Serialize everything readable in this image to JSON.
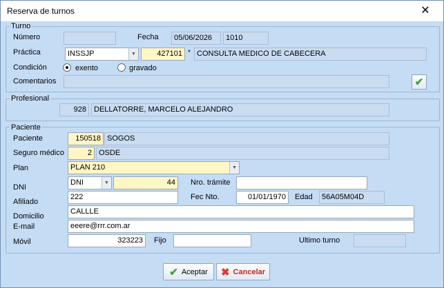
{
  "window": {
    "title": "Reserva de turnos",
    "close_glyph": "✕"
  },
  "turno": {
    "legend": "Turno",
    "numero_label": "Número",
    "numero_value": "",
    "fecha_label": "Fecha",
    "fecha_value": "05/06/2026",
    "hora_value": "1010",
    "practica_label": "Práctica",
    "practica_combo": "INSSJP",
    "practica_code": "427101",
    "practica_marker": "*",
    "practica_desc": "CONSULTA MEDICO DE CABECERA",
    "condicion_label": "Condición",
    "exento_label": "exento",
    "gravado_label": "gravado",
    "comentarios_label": "Comentarios",
    "comentarios_value": ""
  },
  "profesional": {
    "legend": "Profesional",
    "code": "928",
    "name": "DELLATORRE, MARCELO ALEJANDRO"
  },
  "paciente": {
    "legend": "Paciente",
    "paciente_label": "Paciente",
    "paciente_code": "150518",
    "paciente_name": "SOGOS",
    "seguro_label": "Seguro médico",
    "seguro_code": "2",
    "seguro_name": "OSDE",
    "plan_label": "Plan",
    "plan_value": "PLAN 210",
    "dni_label": "DNI",
    "dni_type": "DNI",
    "dni_value": "44",
    "tramite_label": "Nro. trámite",
    "tramite_value": "",
    "afiliado_label": "Afiliado",
    "afiliado_value": "222",
    "fecnto_label": "Fec Nto.",
    "fecnto_value": "01/01/1970",
    "edad_label": "Edad",
    "edad_value": "56A05M04D",
    "domicilio_label": "Domicilio",
    "domicilio_value": "CALLLE",
    "email_label": "E-mail",
    "email_value": "eeere@rrr.com.ar",
    "movil_label": "Móvil",
    "movil_value": "323223",
    "fijo_label": "Fijo",
    "fijo_value": "",
    "ultimo_label": "Ultimo turno",
    "ultimo_value": ""
  },
  "buttons": {
    "aceptar": "Aceptar",
    "cancelar": "Cancelar"
  },
  "icons": {
    "check": "check-icon",
    "cross": "cross-icon",
    "combo": "chevron-down-icon"
  },
  "colors": {
    "window_bg": "#c5dcf5",
    "yellow_field": "#fff6c6",
    "cancel_text": "#c0281e",
    "accept_icon": "#3aa03a"
  }
}
